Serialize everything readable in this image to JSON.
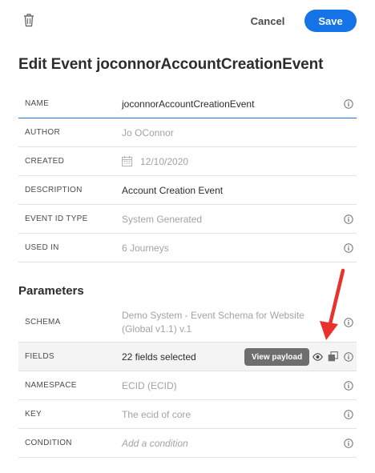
{
  "toolbar": {
    "delete_icon": "trash-icon",
    "cancel_label": "Cancel",
    "save_label": "Save"
  },
  "page_title": "Edit Event joconnorAccountCreationEvent",
  "details": {
    "name": {
      "label": "NAME",
      "value": "joconnorAccountCreationEvent"
    },
    "author": {
      "label": "AUTHOR",
      "value": "Jo OConnor"
    },
    "created": {
      "label": "CREATED",
      "value": "12/10/2020",
      "icon": "calendar-icon"
    },
    "description": {
      "label": "DESCRIPTION",
      "value": "Account Creation Event"
    },
    "event_id_type": {
      "label": "EVENT ID TYPE",
      "value": "System Generated"
    },
    "used_in": {
      "label": "USED IN",
      "value": "6 Journeys"
    }
  },
  "parameters": {
    "title": "Parameters",
    "schema": {
      "label": "SCHEMA",
      "value_line1": "Demo System - Event Schema for Website",
      "value_line2": "(Global v1.1) v.1"
    },
    "fields": {
      "label": "FIELDS",
      "value": "22 fields selected",
      "tooltip": "View payload"
    },
    "namespace": {
      "label": "NAMESPACE",
      "value": "ECID (ECID)"
    },
    "key": {
      "label": "KEY",
      "value": "The ecid of core"
    },
    "condition": {
      "label": "CONDITION",
      "value": "Add a condition"
    }
  },
  "colors": {
    "accent": "#1473e6",
    "annotation_arrow": "#e8322b"
  }
}
